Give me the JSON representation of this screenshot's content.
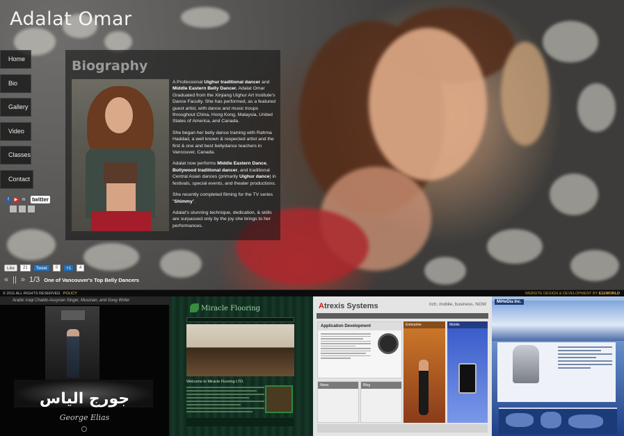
{
  "site": {
    "title": "Adalat Omar"
  },
  "nav": {
    "items": [
      {
        "label": "Home"
      },
      {
        "label": "Bio"
      },
      {
        "label": "Gallery"
      },
      {
        "label": "Video"
      },
      {
        "label": "Classes"
      },
      {
        "label": "Contact"
      }
    ]
  },
  "social": {
    "twitter_label": "twitter",
    "icons": [
      "facebook-icon",
      "youtube-icon",
      "myspace-icon"
    ]
  },
  "bio": {
    "heading": "Biography",
    "p1_a": "A Professional ",
    "p1_b": "Uighur traditional dancer",
    "p1_c": " and ",
    "p1_d": "Middle Eastern Belly Dancer.",
    "p1_e": " Adalat Omar Graduated from the Xinjiang Uighur Art Institute's Dance Faculty. She has performed, as a featured guest artist, with dance and music troups throughout China, Hong Kong, Malaysia, United States of America, and Canada.",
    "p2": "She began her belly dance training with Rahma Haddad, a well known & respected artist and the first & one and best bellydance teachers in Vancouver, Canada.",
    "p3_a": "Adalat now performs ",
    "p3_b": "Middle Eastern Dance",
    "p3_c": ", ",
    "p3_d": "Bollywood traditional dancer",
    "p3_e": ", and traditional Central Asian dances (primarily ",
    "p3_f": "Uighur dance",
    "p3_g": ") in festivals, special events, and theater productions.",
    "p4_a": "She recently completed filming for the TV series \"",
    "p4_b": "Shimmy",
    "p4_c": "\".",
    "p5": "Adalat's stunning technique, dedication, & skills are surpassed only by the joy she brings to her performances."
  },
  "share": {
    "like_label": "Like",
    "like_count": "21",
    "tweet_label": "Tweet",
    "tweet_count": "0",
    "plusone_label": "+1",
    "plusone_count": "4"
  },
  "slider": {
    "prev": "«",
    "pause": "||",
    "next": "»",
    "counter": "1/3",
    "caption": "One of Vancouver's Top Belly Dancers"
  },
  "footer": {
    "copyright": "© 2011 ALL RIGHTS RESERVED.",
    "policy": "POLICY",
    "credit_prefix": "WEBSITE DESIGN & DEVELOPMENT BY ",
    "credit_brand": "E11WORLD"
  },
  "portfolio": {
    "george": {
      "tagline": "Arabic Iraqi Chaldo-Assyrian Singer, Musician, and Song Writer",
      "arabic_name": "جورج الياس",
      "latin_name": "George Elias"
    },
    "miracle": {
      "brand": "Miracle Flooring",
      "welcome": "Welcome to Miracle Flooring LTD."
    },
    "atrexis": {
      "brand_a": "A",
      "brand_rest": "trexis Systems",
      "tagline": "rich, mobile, business, NOW",
      "app_dev": "Application Development",
      "enterprise": "Enterprise",
      "mobile": "Mobile",
      "news": "News",
      "blog": "Blog"
    },
    "mihedia": {
      "brand": "MiHeDia Inc."
    }
  }
}
